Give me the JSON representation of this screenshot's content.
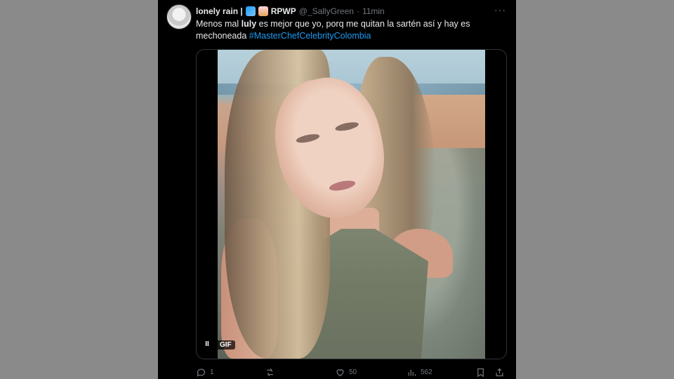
{
  "tweet": {
    "author": {
      "name": "lonely rain |",
      "name_suffix": "RPWP",
      "handle": "@_SallyGreen",
      "separator": "·",
      "time": "11min"
    },
    "text": {
      "part1": "Menos mal ",
      "bold": "luly",
      "part2": " es mejor que yo, porq me quitan la sartén así y hay es mechoneada ",
      "hashtag": "#MasterChefCelebrityColombia"
    },
    "media": {
      "pause_label": "II",
      "gif_label": "GIF"
    },
    "actions": {
      "replies": "1",
      "reposts": "",
      "likes": "50",
      "views": "562"
    },
    "more_label": "···"
  },
  "colors": {
    "background": "#000000",
    "text": "#e7e9ea",
    "muted": "#71767b",
    "link": "#1d9bf0"
  }
}
